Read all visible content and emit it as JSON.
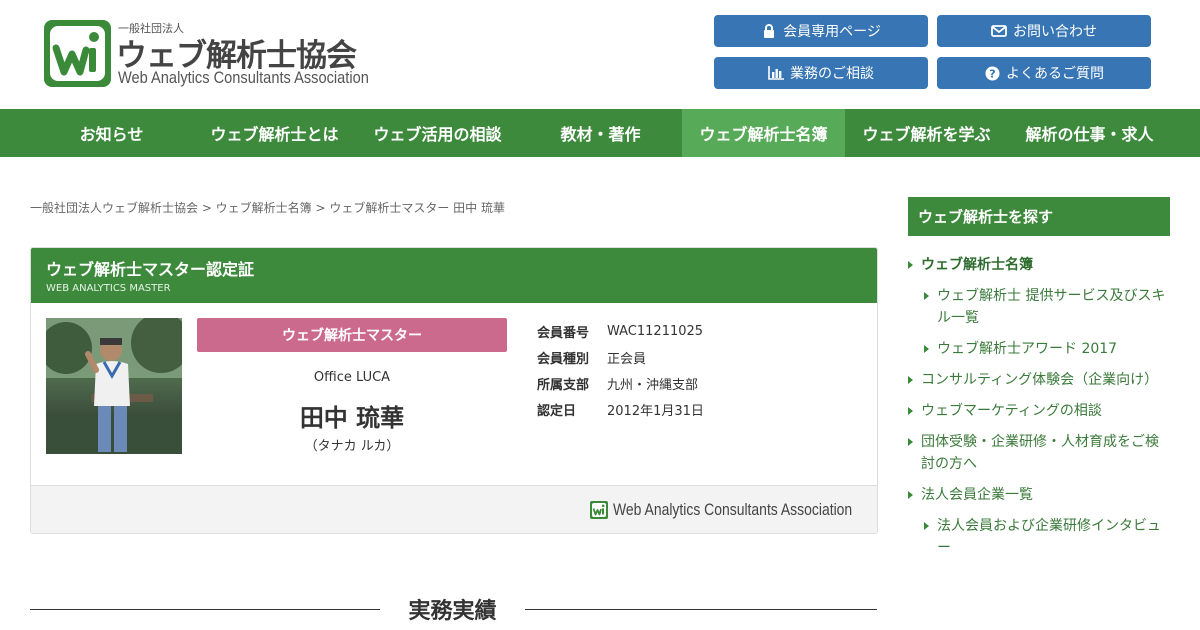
{
  "logo": {
    "small": "一般社団法人",
    "main": "ウェブ解析士協会",
    "en": "Web Analytics Consultants Association"
  },
  "header_buttons": [
    {
      "label": "会員専用ページ",
      "icon": "lock-icon"
    },
    {
      "label": "お問い合わせ",
      "icon": "envelope-icon"
    },
    {
      "label": "業務のご相談",
      "icon": "bar-chart-icon"
    },
    {
      "label": "よくあるご質問",
      "icon": "question-circle-icon"
    }
  ],
  "nav": {
    "items": [
      "お知らせ",
      "ウェブ解析士とは",
      "ウェブ活用の相談",
      "教材・著作",
      "ウェブ解析士名簿",
      "ウェブ解析を学ぶ",
      "解析の仕事・求人"
    ],
    "active": "ウェブ解析士名簿"
  },
  "breadcrumb": "一般社団法人ウェブ解析士協会 > ウェブ解析士名簿 > ウェブ解析士マスター 田中 琉華",
  "card": {
    "title": "ウェブ解析士マスター認定証",
    "subtitle": "WEB ANALYTICS MASTER",
    "rank": "ウェブ解析士マスター",
    "company": "Office LUCA",
    "name": "田中 琉華",
    "kana": "（タナカ ルカ）",
    "info": [
      {
        "label": "会員番号",
        "value": "WAC11211025"
      },
      {
        "label": "会員種別",
        "value": "正会員"
      },
      {
        "label": "所属支部",
        "value": "九州・沖縄支部"
      },
      {
        "label": "認定日",
        "value": "2012年1月31日"
      }
    ],
    "footer_logo_text": "Web Analytics Consultants Association"
  },
  "section_title": "実務実績",
  "sidebar": {
    "title": "ウェブ解析士を探す",
    "items": [
      {
        "label": "ウェブ解析士名簿"
      },
      {
        "label": "ウェブ解析士 提供サービス及びスキル一覧"
      },
      {
        "label": "ウェブ解析士アワード 2017"
      },
      {
        "label": "コンサルティング体験会（企業向け）"
      },
      {
        "label": "ウェブマーケティングの相談"
      },
      {
        "label": "団体受験・企業研修・人材育成をご検討の方へ"
      },
      {
        "label": "法人会員企業一覧"
      },
      {
        "label": "法人会員および企業研修インタビュー"
      }
    ]
  },
  "colors": {
    "brand_green": "#3d8a3d",
    "nav_active": "#57aa57",
    "button_blue": "#3775b4",
    "rank_pink": "#cc6a8e"
  }
}
